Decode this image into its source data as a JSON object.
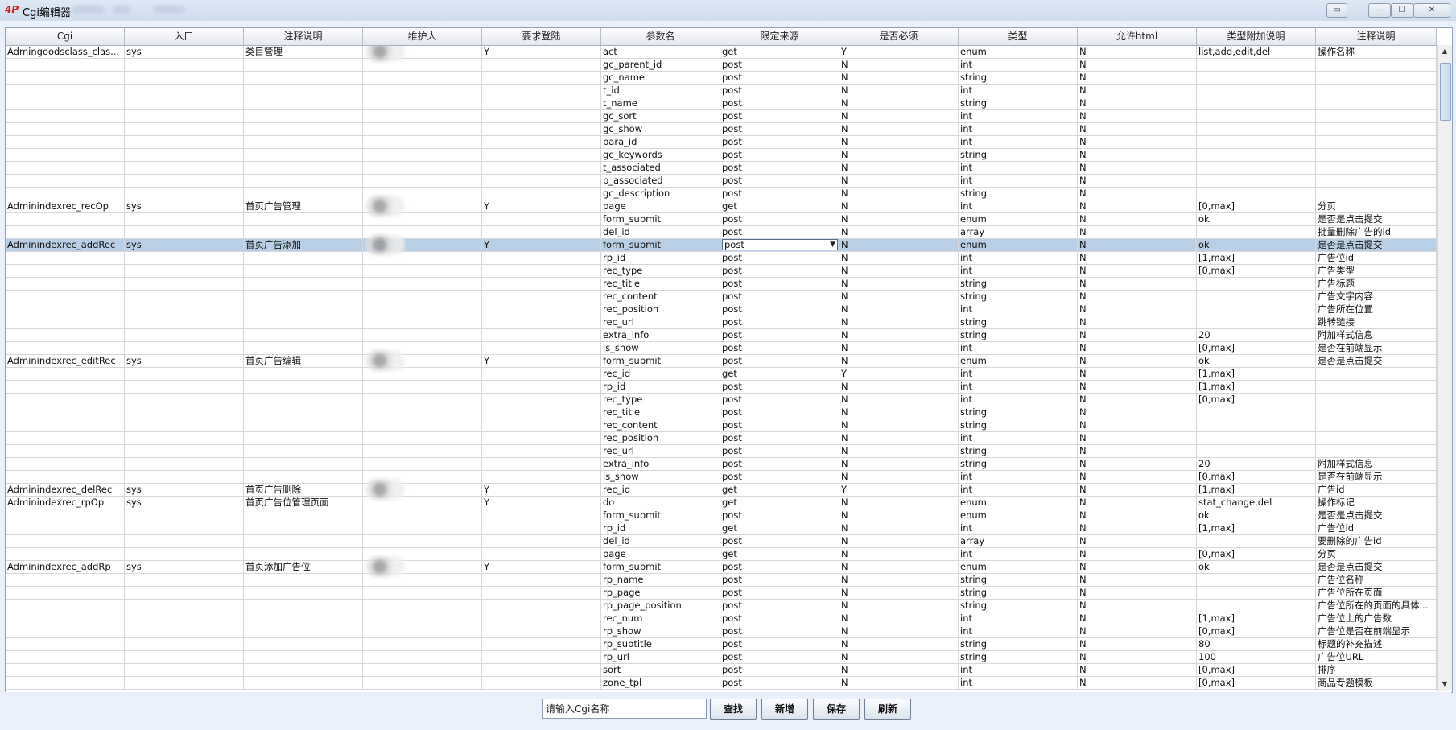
{
  "window": {
    "title": "Cgi编辑器",
    "icon_text": "4P",
    "controls": {
      "extra": "▭",
      "minimize": "—",
      "maximize": "☐",
      "close": "✕"
    }
  },
  "table": {
    "columns": [
      "Cgi",
      "入口",
      "注释说明",
      "维护人",
      "要求登陆",
      "参数名",
      "限定来源",
      "是否必须",
      "类型",
      "允许html",
      "类型附加说明",
      "注释说明"
    ],
    "rows": [
      [
        "Admingoodsclass_clas...",
        "sys",
        "类目管理",
        "",
        "Y",
        "act",
        "get",
        "Y",
        "enum",
        "N",
        "list,add,edit,del",
        "操作名称"
      ],
      [
        "",
        "",
        "",
        "",
        "",
        "gc_parent_id",
        "post",
        "N",
        "int",
        "N",
        "",
        ""
      ],
      [
        "",
        "",
        "",
        "",
        "",
        "gc_name",
        "post",
        "N",
        "string",
        "N",
        "",
        ""
      ],
      [
        "",
        "",
        "",
        "",
        "",
        "t_id",
        "post",
        "N",
        "int",
        "N",
        "",
        ""
      ],
      [
        "",
        "",
        "",
        "",
        "",
        "t_name",
        "post",
        "N",
        "string",
        "N",
        "",
        ""
      ],
      [
        "",
        "",
        "",
        "",
        "",
        "gc_sort",
        "post",
        "N",
        "int",
        "N",
        "",
        ""
      ],
      [
        "",
        "",
        "",
        "",
        "",
        "gc_show",
        "post",
        "N",
        "int",
        "N",
        "",
        ""
      ],
      [
        "",
        "",
        "",
        "",
        "",
        "para_id",
        "post",
        "N",
        "int",
        "N",
        "",
        ""
      ],
      [
        "",
        "",
        "",
        "",
        "",
        "gc_keywords",
        "post",
        "N",
        "string",
        "N",
        "",
        ""
      ],
      [
        "",
        "",
        "",
        "",
        "",
        "t_associated",
        "post",
        "N",
        "int",
        "N",
        "",
        ""
      ],
      [
        "",
        "",
        "",
        "",
        "",
        "p_associated",
        "post",
        "N",
        "int",
        "N",
        "",
        ""
      ],
      [
        "",
        "",
        "",
        "",
        "",
        "gc_description",
        "post",
        "N",
        "string",
        "N",
        "",
        ""
      ],
      [
        "Adminindexrec_recOp",
        "sys",
        "首页广告管理",
        "",
        "Y",
        "page",
        "get",
        "N",
        "int",
        "N",
        "[0,max]",
        "分页"
      ],
      [
        "",
        "",
        "",
        "",
        "",
        "form_submit",
        "post",
        "N",
        "enum",
        "N",
        "ok",
        "是否是点击提交"
      ],
      [
        "",
        "",
        "",
        "",
        "",
        "del_id",
        "post",
        "N",
        "array",
        "N",
        "",
        "批量删除广告的id"
      ],
      [
        "Adminindexrec_addRec",
        "sys",
        "首页广告添加",
        "",
        "Y",
        "form_submit",
        "post",
        "N",
        "enum",
        "N",
        "ok",
        "是否是点击提交"
      ],
      [
        "",
        "",
        "",
        "",
        "",
        "rp_id",
        "post",
        "N",
        "int",
        "N",
        "[1,max]",
        "广告位id"
      ],
      [
        "",
        "",
        "",
        "",
        "",
        "rec_type",
        "post",
        "N",
        "int",
        "N",
        "[0,max]",
        "广告类型"
      ],
      [
        "",
        "",
        "",
        "",
        "",
        "rec_title",
        "post",
        "N",
        "string",
        "N",
        "",
        "广告标题"
      ],
      [
        "",
        "",
        "",
        "",
        "",
        "rec_content",
        "post",
        "N",
        "string",
        "N",
        "",
        "广告文字内容"
      ],
      [
        "",
        "",
        "",
        "",
        "",
        "rec_position",
        "post",
        "N",
        "int",
        "N",
        "",
        "广告所在位置"
      ],
      [
        "",
        "",
        "",
        "",
        "",
        "rec_url",
        "post",
        "N",
        "string",
        "N",
        "",
        "跳转链接"
      ],
      [
        "",
        "",
        "",
        "",
        "",
        "extra_info",
        "post",
        "N",
        "string",
        "N",
        "20",
        "附加样式信息"
      ],
      [
        "",
        "",
        "",
        "",
        "",
        "is_show",
        "post",
        "N",
        "int",
        "N",
        "[0,max]",
        "是否在前端显示"
      ],
      [
        "Adminindexrec_editRec",
        "sys",
        "首页广告编辑",
        "",
        "Y",
        "form_submit",
        "post",
        "N",
        "enum",
        "N",
        "ok",
        "是否是点击提交"
      ],
      [
        "",
        "",
        "",
        "",
        "",
        "rec_id",
        "get",
        "Y",
        "int",
        "N",
        "[1,max]",
        ""
      ],
      [
        "",
        "",
        "",
        "",
        "",
        "rp_id",
        "post",
        "N",
        "int",
        "N",
        "[1,max]",
        ""
      ],
      [
        "",
        "",
        "",
        "",
        "",
        "rec_type",
        "post",
        "N",
        "int",
        "N",
        "[0,max]",
        ""
      ],
      [
        "",
        "",
        "",
        "",
        "",
        "rec_title",
        "post",
        "N",
        "string",
        "N",
        "",
        ""
      ],
      [
        "",
        "",
        "",
        "",
        "",
        "rec_content",
        "post",
        "N",
        "string",
        "N",
        "",
        ""
      ],
      [
        "",
        "",
        "",
        "",
        "",
        "rec_position",
        "post",
        "N",
        "int",
        "N",
        "",
        ""
      ],
      [
        "",
        "",
        "",
        "",
        "",
        "rec_url",
        "post",
        "N",
        "string",
        "N",
        "",
        ""
      ],
      [
        "",
        "",
        "",
        "",
        "",
        "extra_info",
        "post",
        "N",
        "string",
        "N",
        "20",
        "附加样式信息"
      ],
      [
        "",
        "",
        "",
        "",
        "",
        "is_show",
        "post",
        "N",
        "int",
        "N",
        "[0,max]",
        "是否在前端显示"
      ],
      [
        "Adminindexrec_delRec",
        "sys",
        "首页广告删除",
        "",
        "Y",
        "rec_id",
        "get",
        "Y",
        "int",
        "N",
        "[1,max]",
        "广告id"
      ],
      [
        "Adminindexrec_rpOp",
        "sys",
        "首页广告位管理页面",
        "",
        "Y",
        "do",
        "get",
        "N",
        "enum",
        "N",
        "stat_change,del",
        "操作标记"
      ],
      [
        "",
        "",
        "",
        "",
        "",
        "form_submit",
        "post",
        "N",
        "enum",
        "N",
        "ok",
        "是否是点击提交"
      ],
      [
        "",
        "",
        "",
        "",
        "",
        "rp_id",
        "get",
        "N",
        "int",
        "N",
        "[1,max]",
        "广告位id"
      ],
      [
        "",
        "",
        "",
        "",
        "",
        "del_id",
        "post",
        "N",
        "array",
        "N",
        "",
        "要删除的广告id"
      ],
      [
        "",
        "",
        "",
        "",
        "",
        "page",
        "get",
        "N",
        "int",
        "N",
        "[0,max]",
        "分页"
      ],
      [
        "Adminindexrec_addRp",
        "sys",
        "首页添加广告位",
        "",
        "Y",
        "form_submit",
        "post",
        "N",
        "enum",
        "N",
        "ok",
        "是否是点击提交"
      ],
      [
        "",
        "",
        "",
        "",
        "",
        "rp_name",
        "post",
        "N",
        "string",
        "N",
        "",
        "广告位名称"
      ],
      [
        "",
        "",
        "",
        "",
        "",
        "rp_page",
        "post",
        "N",
        "string",
        "N",
        "",
        "广告位所在页面"
      ],
      [
        "",
        "",
        "",
        "",
        "",
        "rp_page_position",
        "post",
        "N",
        "string",
        "N",
        "",
        "广告位所在的页面的具体..."
      ],
      [
        "",
        "",
        "",
        "",
        "",
        "rec_num",
        "post",
        "N",
        "int",
        "N",
        "[1,max]",
        "广告位上的广告数"
      ],
      [
        "",
        "",
        "",
        "",
        "",
        "rp_show",
        "post",
        "N",
        "int",
        "N",
        "[0,max]",
        "广告位是否在前端显示"
      ],
      [
        "",
        "",
        "",
        "",
        "",
        "rp_subtitle",
        "post",
        "N",
        "string",
        "N",
        "80",
        "标题的补充描述"
      ],
      [
        "",
        "",
        "",
        "",
        "",
        "rp_url",
        "post",
        "N",
        "string",
        "N",
        "100",
        "广告位URL"
      ],
      [
        "",
        "",
        "",
        "",
        "",
        "sort",
        "post",
        "N",
        "int",
        "N",
        "[0,max]",
        "排序"
      ],
      [
        "",
        "",
        "",
        "",
        "",
        "zone_tpl",
        "post",
        "N",
        "int",
        "N",
        "[0,max]",
        "商品专题模板"
      ]
    ],
    "selected_row": 15,
    "combo_value": "post",
    "avatar_rows": [
      0,
      12,
      15,
      24,
      34,
      40
    ]
  },
  "toolbar": {
    "search_placeholder": "请输入Cgi名称",
    "find_label": "查找",
    "add_label": "新增",
    "save_label": "保存",
    "refresh_label": "刷新"
  }
}
